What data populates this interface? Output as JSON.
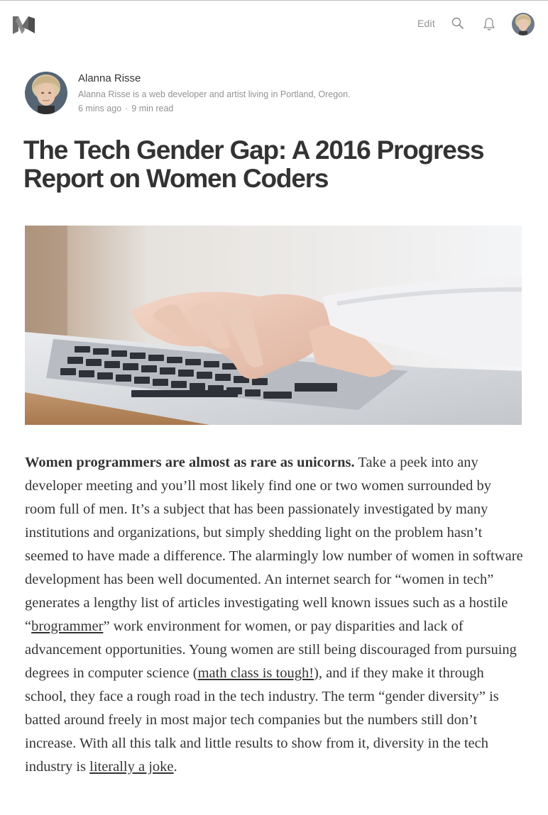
{
  "nav": {
    "logo_icon": "medium-logo-icon",
    "edit_label": "Edit",
    "search_icon": "search-icon",
    "notifications_icon": "bell-icon",
    "avatar_icon": "user-avatar"
  },
  "author": {
    "name": "Alanna Risse",
    "bio": "Alanna Risse is a web developer and artist living in Portland, Oregon.",
    "time_ago": "6 mins ago",
    "separator": "·",
    "read_time": "9 min read"
  },
  "article": {
    "title": "The Tech Gender Gap: A 2016 Progress Report on Women Coders",
    "hero_image_icon": "hands-typing-on-laptop-image",
    "p1_lead": "Women programmers are almost as rare as unicorns.",
    "p1_part1": " Take a peek into any developer meeting and you’ll most likely find one or two women surrounded by room full of men. It’s a subject that has been passionately investigated by many institutions and organizations, but simply shedding light on the problem hasn’t seemed to have made a difference. The alarmingly low number of women in software development has been well documented. An internet search for “women in tech” generates a lengthy list of articles investigating well known issues such as a hostile “",
    "link_brogrammer": "brogrammer",
    "p1_part2": "” work environment for women, or pay disparities and lack of advancement opportunities. Young women are still being discouraged from pursuing degrees in computer science (",
    "link_math": "math class is tough!",
    "p1_part3": "), and if they make it through school, they face a rough road in the tech industry. The term “gender diversity” is batted around freely in most major tech companies but the numbers still don’t increase. With all this talk and little results to show from it, diversity in the tech industry is ",
    "link_joke": "literally a joke",
    "p1_part4": "."
  },
  "colors": {
    "text": "#333333",
    "muted": "#8f8f8f",
    "logo": "#5a5a5a"
  }
}
